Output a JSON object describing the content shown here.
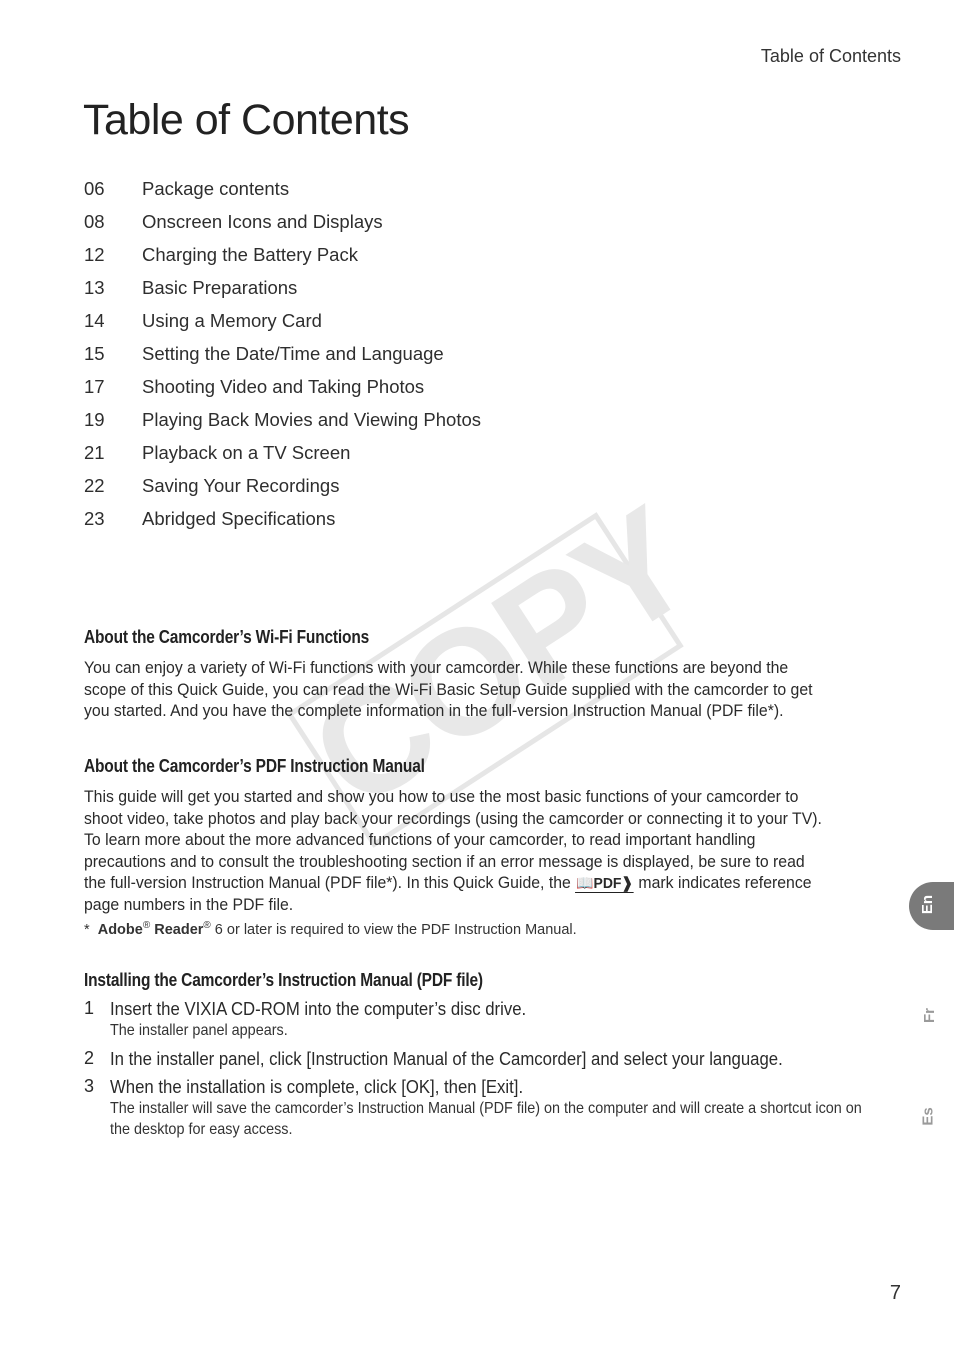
{
  "header": {
    "running_title": "Table of Contents"
  },
  "title": "Table of Contents",
  "toc": [
    {
      "page": "06",
      "label": "Package contents"
    },
    {
      "page": "08",
      "label": "Onscreen Icons and Displays"
    },
    {
      "page": "12",
      "label": "Charging the Battery Pack"
    },
    {
      "page": "13",
      "label": "Basic Preparations"
    },
    {
      "page": "14",
      "label": "Using a Memory Card"
    },
    {
      "page": "15",
      "label": "Setting the Date/Time and Language"
    },
    {
      "page": "17",
      "label": "Shooting Video and Taking Photos"
    },
    {
      "page": "19",
      "label": "Playing Back Movies and Viewing Photos"
    },
    {
      "page": "21",
      "label": "Playback on a TV Screen"
    },
    {
      "page": "22",
      "label": "Saving Your Recordings"
    },
    {
      "page": "23",
      "label": "Abridged Specifications"
    }
  ],
  "wifi": {
    "heading": "About the Camcorder’s Wi-Fi Functions",
    "body": "You can enjoy a variety of Wi-Fi functions with your camcorder. While these functions are beyond the scope of this Quick Guide, you can read the Wi-Fi Basic Setup Guide supplied with the camcorder to get you started. And you have the complete information in the full-version Instruction Manual (PDF file*)."
  },
  "pdf_manual": {
    "heading": "About the Camcorder’s PDF Instruction Manual",
    "body_before_mark": "This guide will get you started and show you how to use the most basic functions of your camcorder to shoot video, take photos and play back your recordings (using the camcorder or connecting it to your TV). To learn more about the more advanced functions of your camcorder, to read important handling precautions and to consult the troubleshooting section if an error message is displayed, be sure to read the full-version Instruction Manual (PDF file*). In this Quick Guide, the ",
    "mark_icon": "pdf-reference-icon",
    "mark_text": "PDF",
    "body_after_mark": " mark indicates reference page numbers in the PDF file."
  },
  "footnote": {
    "asterisk": "*",
    "adobe": "Adobe",
    "reader": "Reader",
    "reg": "®",
    "text": " 6 or later is required to view the PDF Instruction Manual."
  },
  "install": {
    "heading": "Installing the Camcorder’s Instruction Manual (PDF file)",
    "steps": [
      {
        "num": "1",
        "main": "Insert the VIXIA CD-ROM into the computer’s disc drive.",
        "sub": "The installer panel appears."
      },
      {
        "num": "2",
        "main": "In the installer panel, click [Instruction Manual of the Camcorder] and select your language.",
        "sub": ""
      },
      {
        "num": "3",
        "main": "When the installation is complete, click [OK], then [Exit].",
        "sub": "The installer will save the camcorder’s Instruction Manual (PDF file) on the computer and will create a shortcut icon on the desktop for easy access."
      }
    ]
  },
  "language_tabs": {
    "active": "En",
    "others": [
      "Fr",
      "Es"
    ]
  },
  "watermark": "COPY",
  "page_number": "7",
  "colors": {
    "text": "#2a2a2a",
    "tab_active": "#7a7a7a",
    "tab_inactive_text": "#9a9a9a",
    "watermark": "#e8e8e8"
  }
}
